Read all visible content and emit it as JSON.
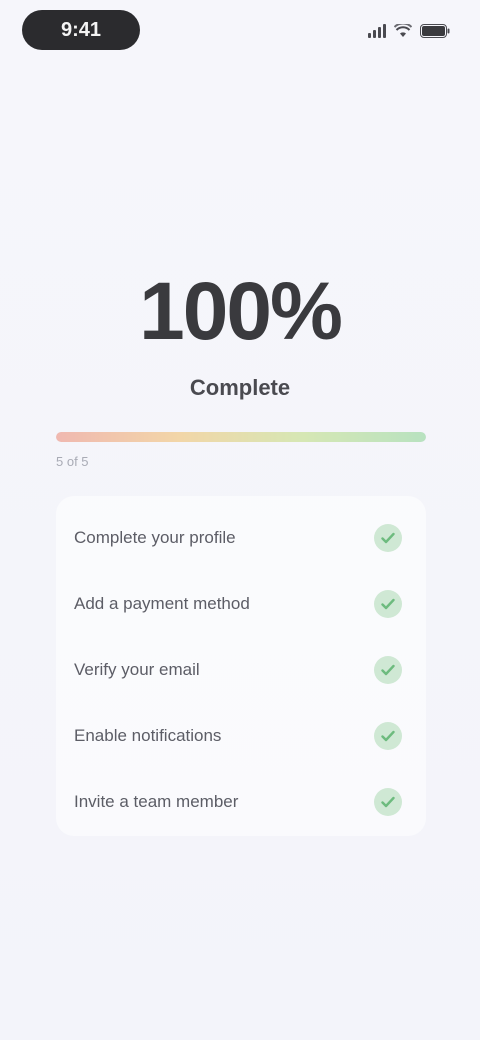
{
  "status_bar": {
    "time": "9:41",
    "icons": [
      "signal-icon",
      "wifi-icon",
      "battery-icon"
    ]
  },
  "hero": {
    "percent": "100%",
    "subtitle": "Complete"
  },
  "progress": {
    "fraction": 1.0,
    "caption": "5 of 5",
    "colors": [
      "#f0b8b0",
      "#f2d6a8",
      "#d6e7b4",
      "#b8e2c0"
    ]
  },
  "checklist": {
    "items": [
      {
        "label": "Complete your profile",
        "done": true
      },
      {
        "label": "Add a payment method",
        "done": true
      },
      {
        "label": "Verify your email",
        "done": true
      },
      {
        "label": "Enable notifications",
        "done": true
      },
      {
        "label": "Invite a team member",
        "done": true
      }
    ],
    "check_color": "#cfe8d4",
    "check_icon": "checkmark-icon"
  }
}
